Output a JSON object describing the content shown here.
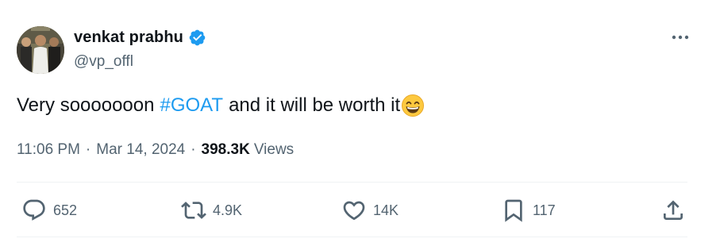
{
  "author": {
    "display_name": "venkat prabhu",
    "handle": "@vp_offl",
    "verified": true,
    "verified_color": "#1d9bf0"
  },
  "tweet": {
    "text_before": "Very sooooooon",
    "hashtag": "#GOAT",
    "text_after": "and it will be worth it",
    "emoji": "grinning-face-with-smiling-eyes"
  },
  "meta": {
    "time": "11:06 PM",
    "separator": "·",
    "date": "Mar 14, 2024",
    "views_count": "398.3K",
    "views_label": "Views"
  },
  "actions": {
    "replies": "652",
    "reposts": "4.9K",
    "likes": "14K",
    "bookmarks": "117"
  },
  "colors": {
    "text": "#0f1419",
    "secondary": "#536471",
    "accent": "#1d9bf0",
    "divider": "#eff3f4"
  },
  "icons": {
    "more": "more-horizontal-icon",
    "reply": "reply-bubble-icon",
    "repost": "repost-icon",
    "like": "heart-icon",
    "bookmark": "bookmark-icon",
    "share": "share-upload-icon"
  }
}
